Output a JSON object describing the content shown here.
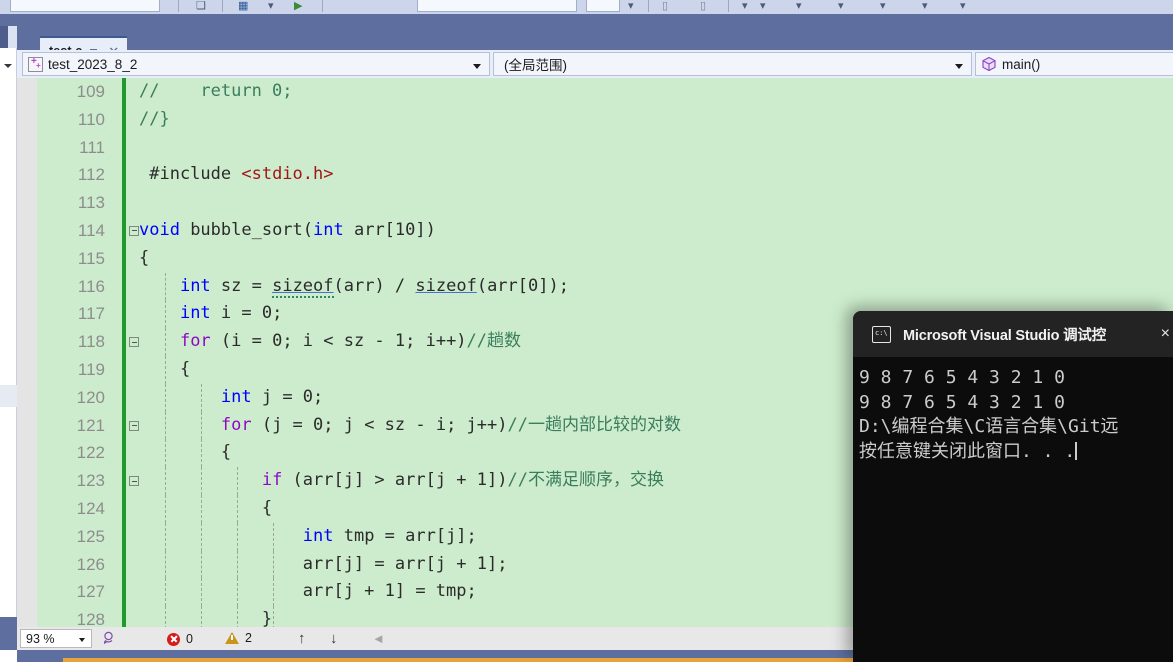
{
  "window": {
    "tab": {
      "label": "test.c",
      "pin_icon": "pin-icon",
      "close_icon": "close-icon"
    }
  },
  "navbar": {
    "project": {
      "value": "test_2023_8_2",
      "icon": "cpp-project-icon"
    },
    "scope": {
      "value": "(全局范围)"
    },
    "member": {
      "value": "main()",
      "icon": "method-cube-icon"
    }
  },
  "editor": {
    "language": "c",
    "first_visible_line": 109,
    "lines": [
      {
        "num": "109",
        "changed": true,
        "fold": false,
        "guides": [],
        "html": "<span class=\"cmt\">//    return 0;</span>"
      },
      {
        "num": "110",
        "changed": true,
        "fold": false,
        "guides": [],
        "html": "<span class=\"cmt\">//}</span>"
      },
      {
        "num": "111",
        "changed": true,
        "fold": false,
        "guides": [],
        "html": ""
      },
      {
        "num": "112",
        "changed": true,
        "fold": false,
        "guides": [],
        "html": " #include <span class=\"str\">&lt;stdio.h&gt;</span>"
      },
      {
        "num": "113",
        "changed": true,
        "fold": false,
        "guides": [],
        "html": ""
      },
      {
        "num": "114",
        "changed": true,
        "fold": true,
        "guides": [],
        "html": "<span class=\"kw\">void</span> bubble_sort(<span class=\"kw\">int</span> arr[<span class=\"num\">10</span>])"
      },
      {
        "num": "115",
        "changed": true,
        "fold": false,
        "guides": [],
        "html": "{"
      },
      {
        "num": "116",
        "changed": true,
        "fold": false,
        "guides": [
          26
        ],
        "html": "    <span class=\"kw\">int</span> sz = <span class=\"sq squig\">sizeof</span>(arr) / <span class=\"sq\">sizeof</span>(arr[0]);"
      },
      {
        "num": "117",
        "changed": true,
        "fold": false,
        "guides": [
          26
        ],
        "html": "    <span class=\"kw\">int</span> i = 0;"
      },
      {
        "num": "118",
        "changed": true,
        "fold": true,
        "guides": [
          26
        ],
        "html": "    <span class=\"kw2\">for</span> (i = 0; i &lt; sz - 1; i++)<span class=\"cmt\">//趟数</span>"
      },
      {
        "num": "119",
        "changed": true,
        "fold": false,
        "guides": [
          26
        ],
        "html": "    {"
      },
      {
        "num": "120",
        "changed": true,
        "fold": false,
        "guides": [
          26,
          62
        ],
        "html": "        <span class=\"kw\">int</span> j = 0;"
      },
      {
        "num": "121",
        "changed": true,
        "fold": true,
        "guides": [
          26,
          62
        ],
        "html": "        <span class=\"kw2\">for</span> (j = 0; j &lt; sz - i; j++)<span class=\"cmt\">//一趟内部比较的对数</span>"
      },
      {
        "num": "122",
        "changed": true,
        "fold": false,
        "guides": [
          26,
          62
        ],
        "html": "        {"
      },
      {
        "num": "123",
        "changed": true,
        "fold": true,
        "guides": [
          26,
          62,
          98
        ],
        "html": "            <span class=\"kw2\">if</span> (arr[j] &gt; arr[j + 1])<span class=\"cmt\">//不满足顺序，交换</span>"
      },
      {
        "num": "124",
        "changed": true,
        "fold": false,
        "guides": [
          26,
          62,
          98
        ],
        "html": "            {"
      },
      {
        "num": "125",
        "changed": true,
        "fold": false,
        "guides": [
          26,
          62,
          98,
          134
        ],
        "html": "                <span class=\"kw\">int</span> tmp = arr[j];"
      },
      {
        "num": "126",
        "changed": true,
        "fold": false,
        "guides": [
          26,
          62,
          98,
          134
        ],
        "html": "                arr[j] = arr[j + 1];"
      },
      {
        "num": "127",
        "changed": true,
        "fold": false,
        "guides": [
          26,
          62,
          98,
          134
        ],
        "html": "                arr[j + 1] = tmp;"
      },
      {
        "num": "128",
        "changed": true,
        "fold": false,
        "guides": [
          26,
          62,
          98,
          134
        ],
        "html": "            }"
      }
    ]
  },
  "status_bar": {
    "zoom": "93 %",
    "feedback_icon": "feedback-person-icon",
    "error_icon": "error-icon",
    "error_count": "0",
    "warning_icon": "warning-icon",
    "warning_count": "2",
    "prev_icon": "↑",
    "next_icon": "↓",
    "collapse_icon": "◄"
  },
  "console": {
    "title": "Microsoft Visual Studio 调试控",
    "icon": "console-prompt-icon",
    "close_icon": "×",
    "lines": [
      "9 8 7 6 5 4 3 2 1 0",
      "9 8 7 6 5 4 3 2 1 0",
      "D:\\编程合集\\C语言合集\\Git远",
      "按任意键关闭此窗口. . ."
    ]
  },
  "colors": {
    "editor_background": "#cdeccd",
    "saved_change_bar": "#1f9b2b",
    "chrome": "#5e6e9e",
    "navbar_background": "#e8eef9",
    "console_background": "#0c0c0c",
    "console_titlebar": "#232323",
    "error_red": "#d51b1b",
    "warning_amber": "#c8951a",
    "keyword_blue": "#0000ff",
    "keyword_purple": "#8f08c4",
    "string_red": "#a31515",
    "comment_green": "#3a7d5c"
  }
}
